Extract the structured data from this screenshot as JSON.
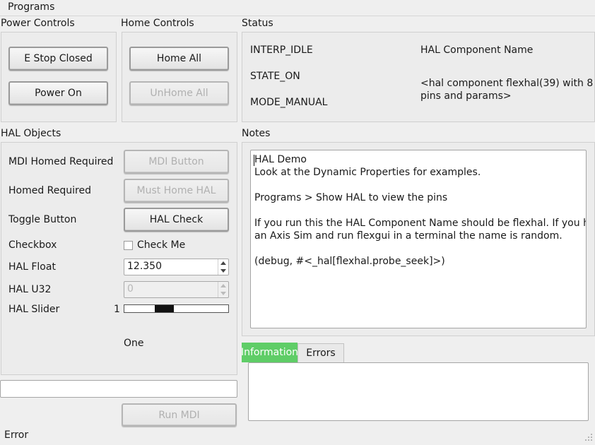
{
  "menubar": {
    "programs": "Programs"
  },
  "power_controls": {
    "title": "Power Controls",
    "estop_label": "E Stop Closed",
    "power_label": "Power On"
  },
  "home_controls": {
    "title": "Home Controls",
    "home_all_label": "Home All",
    "unhome_all_label": "UnHome All"
  },
  "status": {
    "title": "Status",
    "interp": "INTERP_IDLE",
    "state": "STATE_ON",
    "mode": "MODE_MANUAL",
    "hal_component_title": "HAL Component Name",
    "hal_component_value_line1": "<hal component flexhal(39) with 8",
    "hal_component_value_line2": "pins and params>"
  },
  "hal_objects": {
    "title": "HAL Objects",
    "mdi_homed_label": "MDI Homed Required",
    "mdi_button_label": "MDI Button",
    "homed_required_label": "Homed Required",
    "must_home_label": "Must Home HAL",
    "toggle_label": "Toggle Button",
    "hal_check_label": "HAL Check",
    "checkbox_label": "Checkbox",
    "check_me_label": "Check Me",
    "hal_float_label": "HAL Float",
    "hal_float_value": "12.350",
    "hal_u32_label": "HAL U32",
    "hal_u32_value": "0",
    "hal_slider_label": "HAL Slider",
    "slider_value_text": "1",
    "slider_position": 0.36,
    "slider_readout": "One"
  },
  "mdi": {
    "input_value": "",
    "run_label": "Run MDI"
  },
  "footer": {
    "error_label": "Error"
  },
  "notes": {
    "title": "Notes",
    "lines": [
      "HAL Demo",
      "Look at the Dynamic Properties for examples.",
      "",
      "Programs > Show HAL to view the pins",
      "",
      "If you run this the HAL Component Name should be flexhal. If you have",
      "an Axis Sim and run flexgui in a terminal the name is random.",
      "",
      "(debug, #<_hal[flexhal.probe_seek]>)"
    ]
  },
  "tabs": {
    "information": "Information",
    "errors": "Errors"
  },
  "colors": {
    "active_tab": "#5fcd67"
  }
}
